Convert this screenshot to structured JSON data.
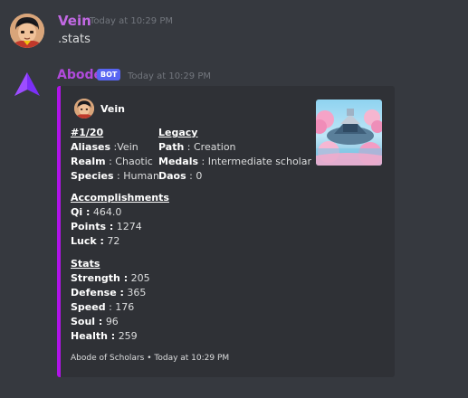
{
  "messages": [
    {
      "author": "Vein",
      "timestamp": "Today at 10:29 PM",
      "content": ".stats",
      "author_color": "#c269e4"
    },
    {
      "author": "Abode",
      "bot_badge": "BOT",
      "timestamp": "Today at 10:29 PM",
      "author_color": "#b14adc",
      "embed": {
        "accent_color": "#b014e8",
        "author_name": "Vein",
        "fields": {
          "rank": {
            "name": "#1/20",
            "lines": [
              {
                "label": "Aliases",
                "sep": " :",
                "value": "Vein"
              },
              {
                "label": "Realm",
                "sep": " : ",
                "value": "Chaotic"
              },
              {
                "label": "Species",
                "sep": " : ",
                "value": "Human"
              }
            ]
          },
          "legacy": {
            "name": "Legacy",
            "lines": [
              {
                "label": "Path",
                "sep": " : ",
                "value": "Creation"
              },
              {
                "label": "Medals",
                "sep": " : ",
                "value": "Intermediate scholar"
              },
              {
                "label": "Daos",
                "sep": " : ",
                "value": "0"
              }
            ]
          },
          "accomplishments": {
            "name": "Accomplishments",
            "lines": [
              {
                "label": "Qi :",
                "sep": " ",
                "value": "464.0"
              },
              {
                "label": "Points :",
                "sep": " ",
                "value": "1274"
              },
              {
                "label": "Luck :",
                "sep": " ",
                "value": "72"
              }
            ]
          },
          "stats": {
            "name": "Stats",
            "lines": [
              {
                "label": "Strength :",
                "sep": " ",
                "value": "205"
              },
              {
                "label": "Defense :",
                "sep": " ",
                "value": "365"
              },
              {
                "label": "Speed",
                "sep": " : ",
                "value": "176"
              },
              {
                "label": "Soul :",
                "sep": " ",
                "value": "96"
              },
              {
                "label": "Health :",
                "sep": " ",
                "value": "259"
              }
            ]
          }
        },
        "footer_text": "Abode of Scholars",
        "footer_separator": "•",
        "footer_timestamp": "Today at 10:29 PM"
      }
    }
  ],
  "icons": {
    "user_avatar": "user-avatar-icon",
    "bot_avatar": "abode-logo-icon",
    "thumbnail": "landscape-thumbnail"
  },
  "colors": {
    "background": "#36393f",
    "embed_background": "#2f3136",
    "bot_badge": "#5865f2"
  }
}
